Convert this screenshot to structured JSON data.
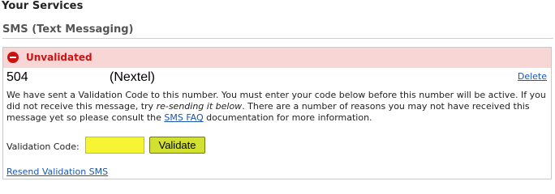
{
  "page": {
    "title": "Your Services"
  },
  "section": {
    "title": "SMS (Text Messaging)"
  },
  "sms_entry": {
    "status": {
      "icon": "no-entry-icon",
      "label": "Unvalidated",
      "color": "#cc1111",
      "background": "#f9d6d6"
    },
    "phone_number": "504",
    "carrier": "(Nextel)",
    "delete_label": "Delete",
    "message": {
      "part1": "We have sent a Validation Code to this number. You must enter your code below before this number will be active. If you did not receive this message, try ",
      "emphasis": "re-sending it below",
      "part2": ". There are a number of reasons you may not have received this message yet so please consult the ",
      "faq_link": "SMS FAQ",
      "part3": " documentation for more information."
    },
    "validation": {
      "label": "Validation Code:",
      "value": "",
      "button_label": "Validate",
      "input_color": "#f5f533",
      "button_color": "#d2e030"
    },
    "resend_label": "Resend Validation SMS"
  },
  "colors": {
    "link": "#1a55b0"
  }
}
